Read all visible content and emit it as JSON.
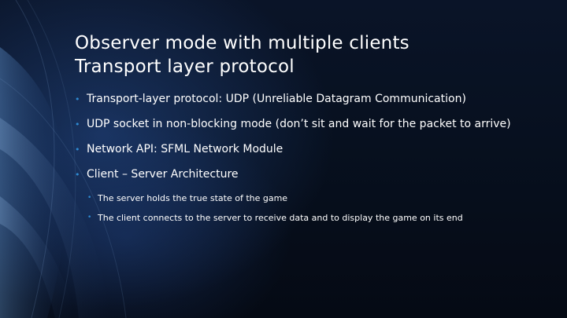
{
  "slide": {
    "title_lines": [
      "Observer mode with multiple clients",
      "Transport layer protocol"
    ],
    "bullets": [
      "Transport-layer protocol: UDP (Unreliable Datagram Communication)",
      "UDP socket in non-blocking mode (don’t sit and wait for the packet to arrive)",
      "Network API: SFML Network Module",
      "Client – Server Architecture"
    ],
    "sub_bullets": [
      "The server holds the true state of the game",
      "The client connects to the server to receive data and to display the game on its end"
    ],
    "bullet_glyph": "•",
    "colors": {
      "background": "#07101f",
      "text": "#ffffff",
      "bullet_accent": "#2e8bd3"
    }
  }
}
